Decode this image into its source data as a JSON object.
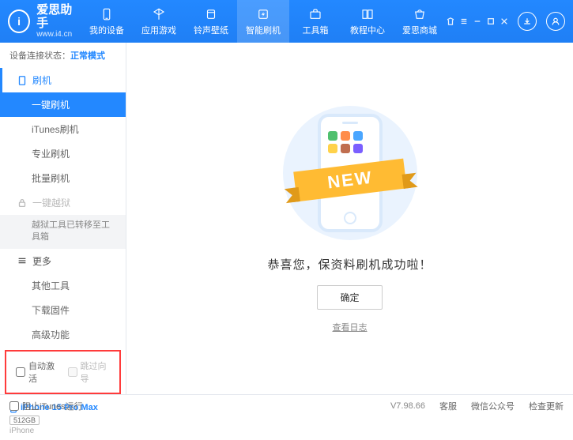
{
  "header": {
    "appName": "爱思助手",
    "appUrl": "www.i4.cn",
    "logoLetter": "i",
    "nav": [
      {
        "label": "我的设备"
      },
      {
        "label": "应用游戏"
      },
      {
        "label": "铃声壁纸"
      },
      {
        "label": "智能刷机"
      },
      {
        "label": "工具箱"
      },
      {
        "label": "教程中心"
      },
      {
        "label": "爱思商城"
      }
    ]
  },
  "sidebar": {
    "statusLabel": "设备连接状态：",
    "statusValue": "正常模式",
    "flashSection": "刷机",
    "flashItems": {
      "oneKey": "一键刷机",
      "itunes": "iTunes刷机",
      "pro": "专业刷机",
      "batch": "批量刷机"
    },
    "jailbreakSection": "一键越狱",
    "jailbreakNote": "越狱工具已转移至工具箱",
    "moreSection": "更多",
    "moreItems": {
      "other": "其他工具",
      "download": "下载固件",
      "advanced": "高级功能"
    },
    "checkboxes": {
      "autoActivate": "自动激活",
      "skipGuide": "跳过向导"
    },
    "device": {
      "name": "iPhone 15 Pro Max",
      "storage": "512GB",
      "type": "iPhone"
    }
  },
  "main": {
    "ribbon": "NEW",
    "successMsg": "恭喜您，保资料刷机成功啦！",
    "okButton": "确定",
    "viewLog": "查看日志"
  },
  "footer": {
    "blockItunes": "阻止iTunes运行",
    "version": "V7.98.66",
    "service": "客服",
    "wechat": "微信公众号",
    "update": "检查更新"
  }
}
